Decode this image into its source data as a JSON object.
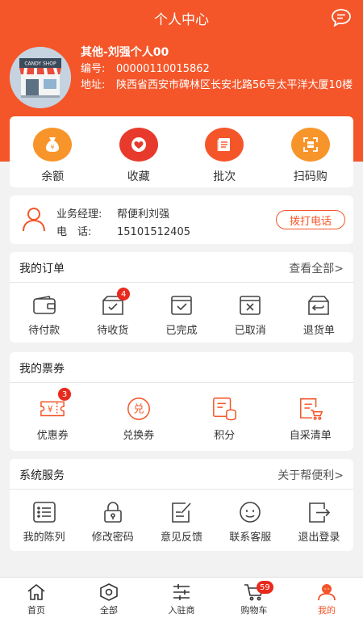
{
  "header": {
    "title": "个人中心"
  },
  "profile": {
    "name": "其他-刘强个人00",
    "id_label": "编号:",
    "id_value": "00000110015862",
    "address_label": "地址:",
    "address_value": "陕西省西安市碑林区长安北路56号太平洋大厦10楼",
    "avatar_sign": "CANDY SHOP"
  },
  "quick": [
    {
      "label": "余额",
      "icon": "money-bag-icon"
    },
    {
      "label": "收藏",
      "icon": "heart-icon"
    },
    {
      "label": "批次",
      "icon": "document-icon"
    },
    {
      "label": "扫码购",
      "icon": "scan-icon"
    }
  ],
  "manager": {
    "role_label": "业务经理:",
    "role_value": "帮便利刘强",
    "phone_label": "电　话:",
    "phone_value": "15101512405",
    "call_button": "拨打电话"
  },
  "orders": {
    "title": "我的订单",
    "link": "查看全部>",
    "items": [
      {
        "label": "待付款",
        "icon": "wallet-icon",
        "badge": ""
      },
      {
        "label": "待收货",
        "icon": "package-icon",
        "badge": "4"
      },
      {
        "label": "已完成",
        "icon": "box-check-icon",
        "badge": ""
      },
      {
        "label": "已取消",
        "icon": "box-x-icon",
        "badge": ""
      },
      {
        "label": "退货单",
        "icon": "return-box-icon",
        "badge": ""
      }
    ]
  },
  "tickets": {
    "title": "我的票券",
    "items": [
      {
        "label": "优惠券",
        "icon": "coupon-icon",
        "badge": "3",
        "icon_text": "¥"
      },
      {
        "label": "兑换券",
        "icon": "exchange-icon",
        "badge": "",
        "icon_text": "兑"
      },
      {
        "label": "积分",
        "icon": "points-icon",
        "badge": ""
      },
      {
        "label": "自采清单",
        "icon": "purchase-list-icon",
        "badge": ""
      }
    ]
  },
  "services": {
    "title": "系统服务",
    "link": "关于帮便利>",
    "items": [
      {
        "label": "我的陈列",
        "icon": "list-icon"
      },
      {
        "label": "修改密码",
        "icon": "lock-icon"
      },
      {
        "label": "意见反馈",
        "icon": "feedback-icon"
      },
      {
        "label": "联系客服",
        "icon": "service-face-icon"
      },
      {
        "label": "退出登录",
        "icon": "logout-icon"
      }
    ]
  },
  "tabbar": [
    {
      "label": "首页",
      "icon": "home-icon",
      "badge": ""
    },
    {
      "label": "全部",
      "icon": "category-icon",
      "badge": ""
    },
    {
      "label": "入驻商",
      "icon": "sliders-icon",
      "badge": ""
    },
    {
      "label": "购物车",
      "icon": "cart-icon",
      "badge": "59"
    },
    {
      "label": "我的",
      "icon": "user-icon",
      "badge": "",
      "active": true
    }
  ],
  "colors": {
    "brand": "#f4562a",
    "orange": "#f7952b",
    "red": "#e83a2c",
    "badge": "#e8291c"
  }
}
